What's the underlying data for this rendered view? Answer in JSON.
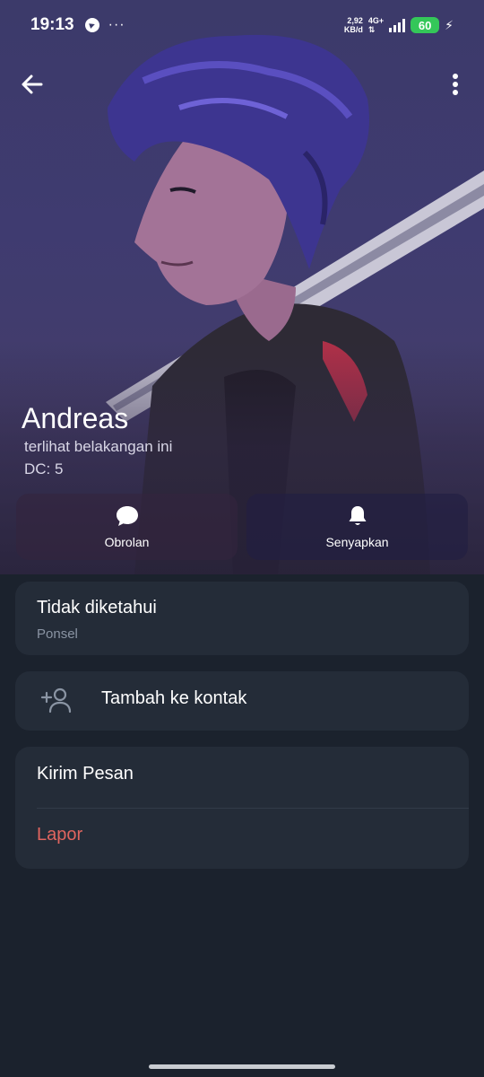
{
  "status_bar": {
    "time": "19:13",
    "dots": "···",
    "net_speed_value": "2,92",
    "net_speed_unit": "KB/d",
    "net_type": "4G+",
    "battery": "60"
  },
  "profile": {
    "name": "Andreas",
    "last_seen": "terlihat belakangan ini",
    "dc": "DC: 5"
  },
  "actions": {
    "chat_label": "Obrolan",
    "mute_label": "Senyapkan"
  },
  "info": {
    "phone_value": "Tidak diketahui",
    "phone_label": "Ponsel"
  },
  "add_contact": {
    "label": "Tambah ke kontak"
  },
  "menu": {
    "send_message": "Kirim Pesan",
    "report": "Lapor"
  },
  "colors": {
    "background": "#1b222d",
    "card": "#242c38",
    "danger": "#e0655f",
    "battery": "#34c759"
  },
  "icons": {
    "back": "arrow-left-icon",
    "more": "more-vertical-icon",
    "chat": "chat-bubble-icon",
    "mute": "bell-icon",
    "add_contact": "add-person-icon"
  }
}
